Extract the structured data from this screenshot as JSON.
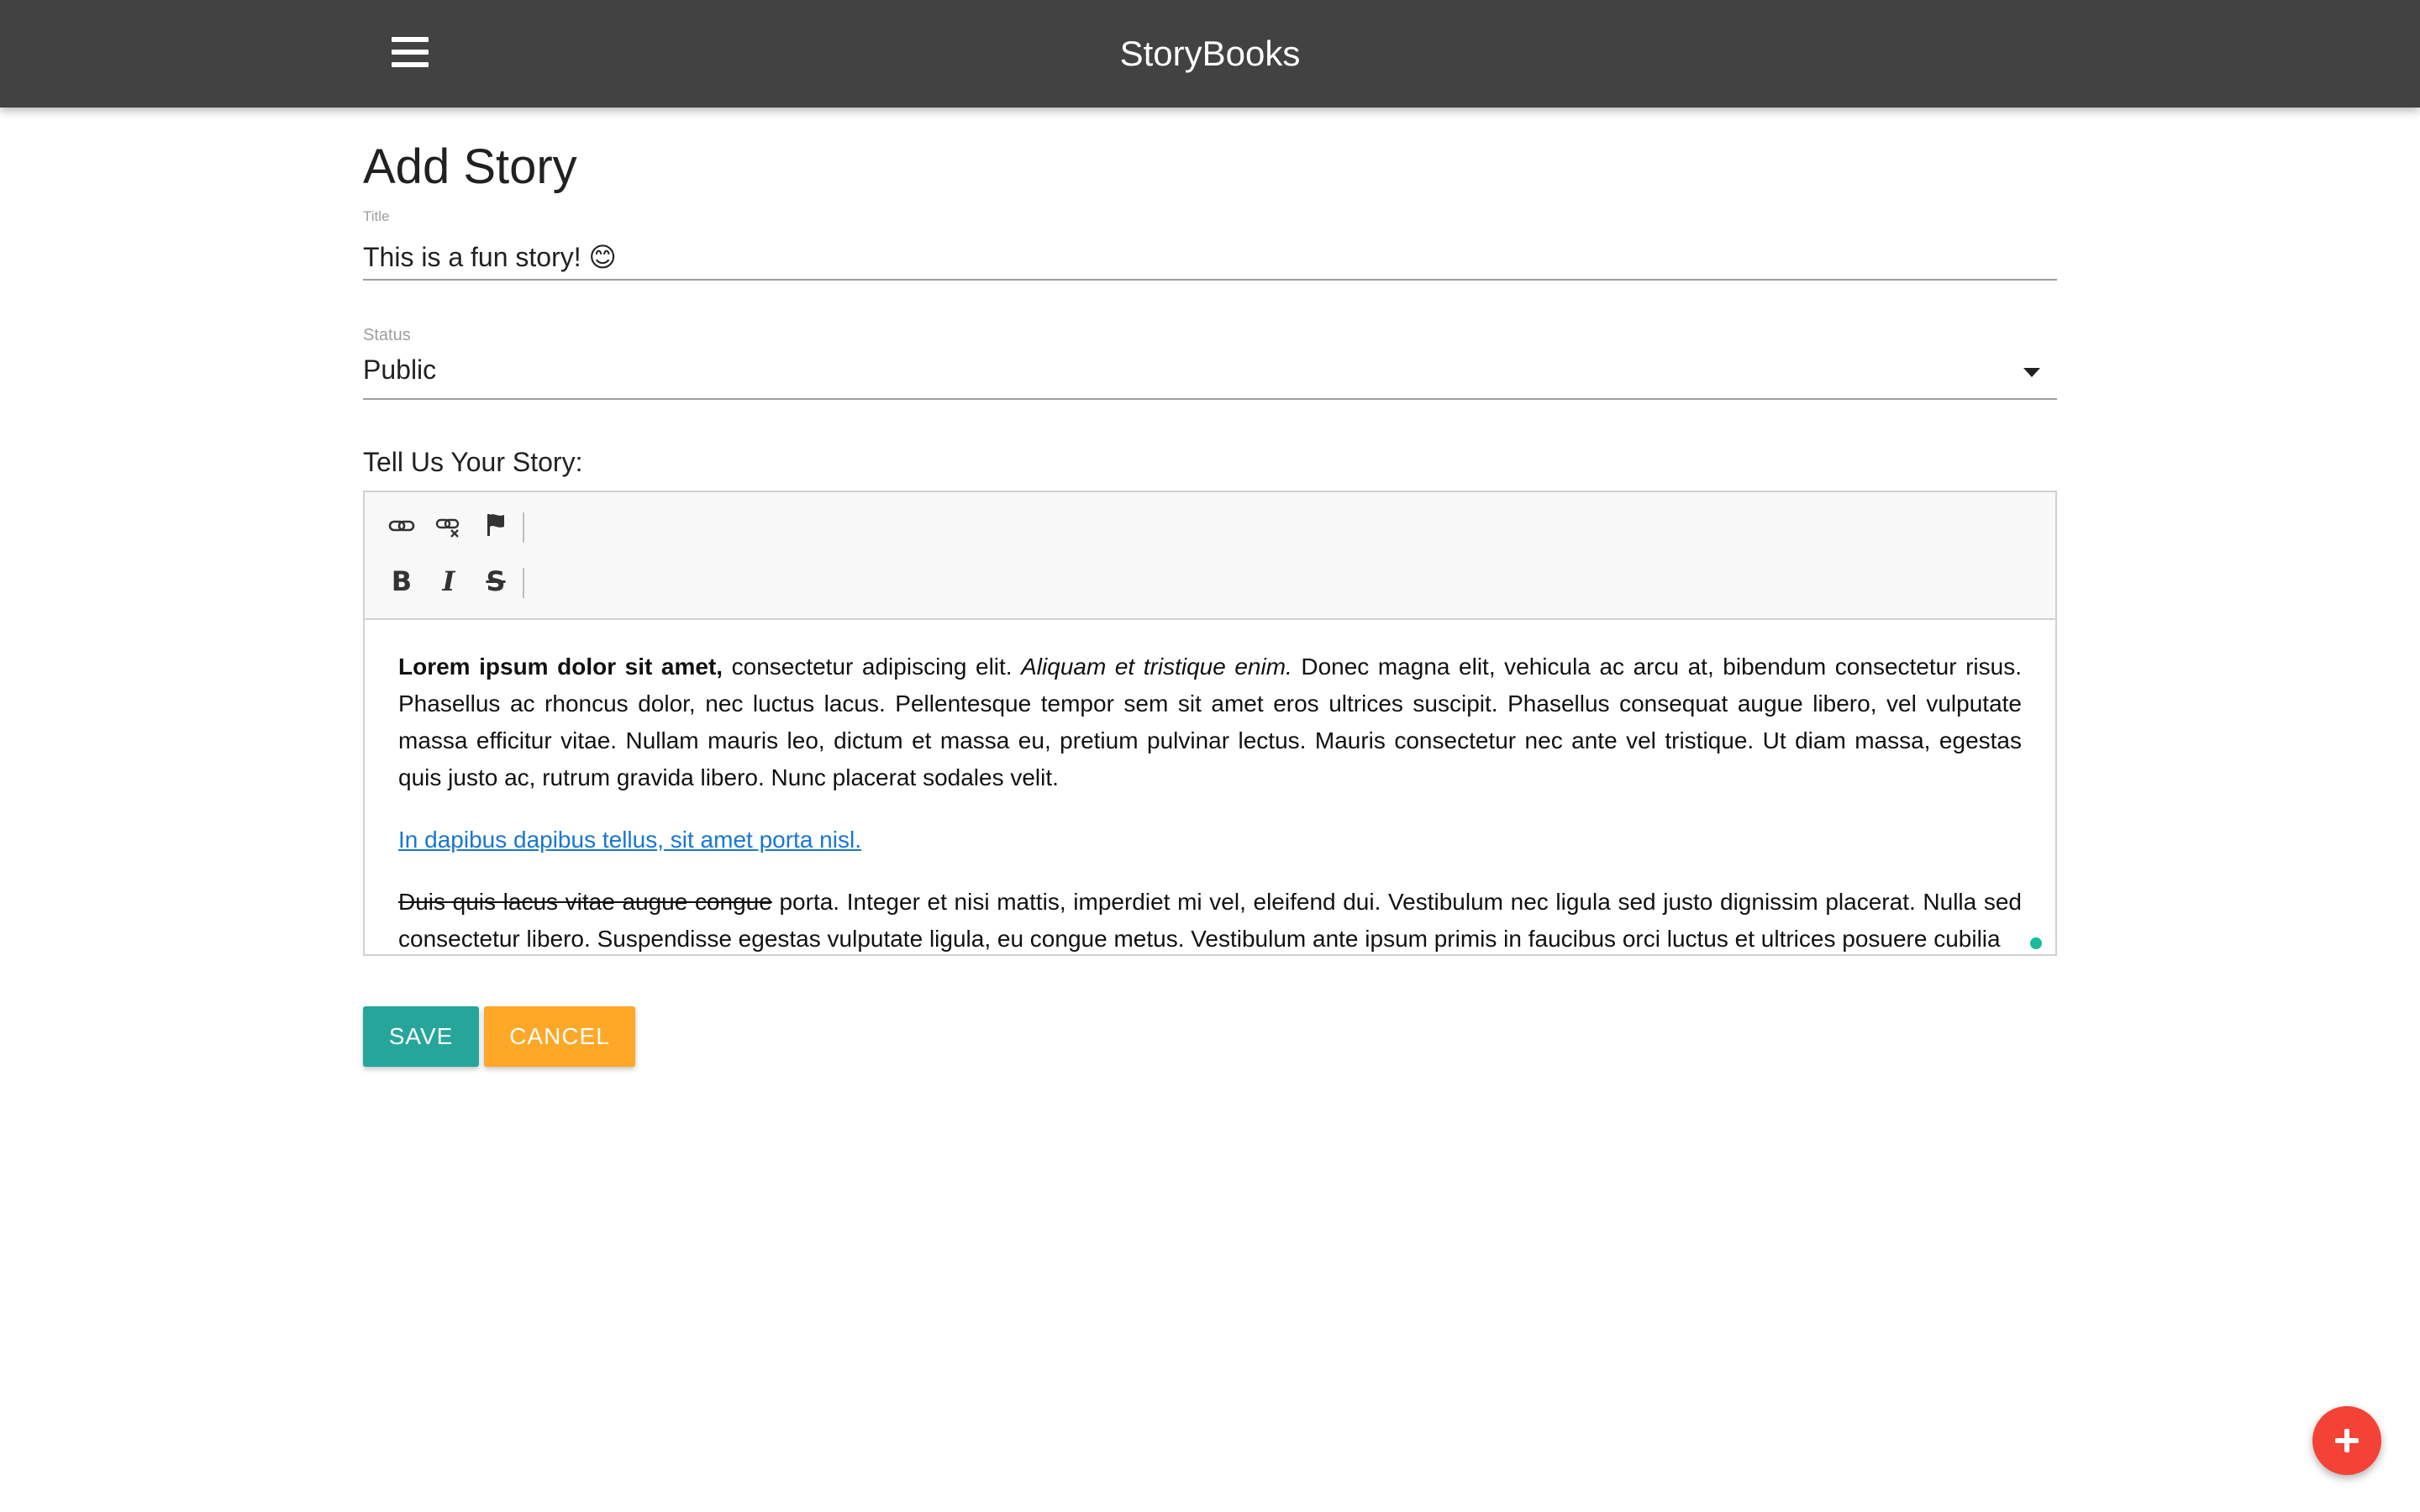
{
  "navbar": {
    "brand": "StoryBooks",
    "menu_icon": "hamburger-menu-icon",
    "background": "#424242"
  },
  "form": {
    "heading": "Add Story",
    "title_label": "Title",
    "title_value": "This is a fun story! 😊",
    "status_label": "Status",
    "status_value": "Public",
    "story_label": "Tell Us Your Story:"
  },
  "editor": {
    "toolbar": {
      "row1": [
        {
          "icon": "link-icon",
          "title": "Link"
        },
        {
          "icon": "unlink-icon",
          "title": "Unlink"
        },
        {
          "icon": "flag-icon",
          "title": "Anchor"
        }
      ],
      "row2": [
        {
          "icon": "bold-icon",
          "glyph": "B"
        },
        {
          "icon": "italic-icon",
          "glyph": "I"
        },
        {
          "icon": "strikethrough-icon",
          "glyph": "S"
        }
      ]
    },
    "p1": {
      "bold": "Lorem ipsum dolor sit amet,",
      "text_a": " consectetur adipiscing elit. ",
      "italic": "Aliquam et tristique enim.",
      "text_b": " Donec magna elit, vehicula ac arcu at, bibendum consectetur risus. Phasellus ac rhoncus dolor, nec luctus lacus. Pellentesque tempor sem sit amet eros ultrices suscipit. Phasellus consequat augue libero, vel vulputate massa efficitur vitae. Nullam mauris leo, dictum et massa eu, pretium pulvinar lectus. Mauris consectetur nec ante vel tristique. Ut diam massa, egestas quis justo ac, rutrum gravida libero. Nunc placerat sodales velit."
    },
    "link_text": " In dapibus dapibus tellus, sit amet porta nisl.",
    "p3": {
      "strike": "Duis quis lacus vitae augue congue",
      "text": " porta. Integer et nisi mattis, imperdiet mi vel, eleifend dui. Vestibulum nec ligula sed justo dignissim placerat. Nulla sed consectetur libero. Suspendisse egestas vulputate ligula, eu congue metus. Vestibulum ante ipsum primis in faucibus orci luctus et ultrices posuere cubilia"
    }
  },
  "buttons": {
    "save": "SAVE",
    "cancel": "CANCEL",
    "save_color": "#26a69a",
    "cancel_color": "#ffa726"
  },
  "fab": {
    "icon": "add-icon",
    "color": "#f44336"
  }
}
